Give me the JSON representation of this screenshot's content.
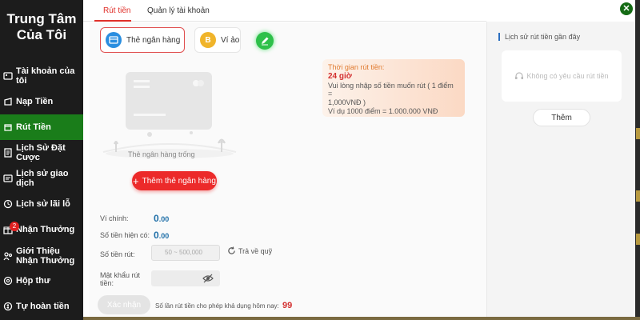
{
  "sidebar": {
    "title_line1": "Trung Tâm",
    "title_line2": "Của Tôi",
    "items": [
      {
        "label": "Tài khoản của tôi",
        "icon": "user-card-icon"
      },
      {
        "label": "Nạp Tiền",
        "icon": "deposit-icon"
      },
      {
        "label": "Rút Tiền",
        "icon": "withdraw-icon",
        "active": true
      },
      {
        "label": "Lịch Sử Đặt Cược",
        "icon": "bet-history-icon"
      },
      {
        "label": "Lịch sử giao dịch",
        "icon": "transaction-icon"
      },
      {
        "label": "Lịch sử lãi lỗ",
        "icon": "profit-loss-icon"
      },
      {
        "label": "Nhận Thưởng",
        "icon": "gift-icon",
        "badge": "2"
      },
      {
        "label": "Giới Thiệu Nhận Thưởng",
        "icon": "referral-icon"
      },
      {
        "label": "Hộp thư",
        "icon": "mail-icon"
      },
      {
        "label": "Tự hoàn tiền",
        "icon": "cashback-icon"
      }
    ]
  },
  "tabs": {
    "withdraw": "Rút tiền",
    "account_mgmt": "Quản lý tài khoản"
  },
  "methods": {
    "bank": "Thẻ ngân hàng",
    "wallet": "Ví ảo"
  },
  "bank": {
    "empty": "Thẻ ngân hàng trống",
    "add_button": "Thêm thẻ ngân hàng"
  },
  "info": {
    "title": "Thời gian rút tiền:",
    "hours": "24 giờ",
    "line1": "Vui lòng nhập số tiền muốn rút ( 1 điểm =",
    "line2": "1,000VNĐ )",
    "line3": "Ví dụ 1000 điểm = 1.000.000 VNĐ"
  },
  "form": {
    "main_wallet_label": "Ví chính:",
    "main_wallet_int": "0",
    "main_wallet_dec": ".00",
    "balance_label": "Số tiền hiện có:",
    "balance_int": "0",
    "balance_dec": ".00",
    "amount_label": "Số tiền rút:",
    "amount_placeholder": "50 ~ 500,000",
    "refund_label": "Trả về quỹ",
    "password_label_1": "Mật khẩu rút",
    "password_label_2": "tiền:",
    "confirm_button": "Xác nhận",
    "limit_text": "Số lần rút tiền cho phép khả dụng hôm nay:",
    "limit_value": "99"
  },
  "history": {
    "title": "Lịch sử rút tiền gần đây",
    "empty": "Không có yêu cầu rút tiền",
    "more_button": "Thêm"
  },
  "colors": {
    "accent_red": "#e0302a",
    "active_green": "#1a7d1a",
    "value_blue": "#1f6fa8"
  }
}
